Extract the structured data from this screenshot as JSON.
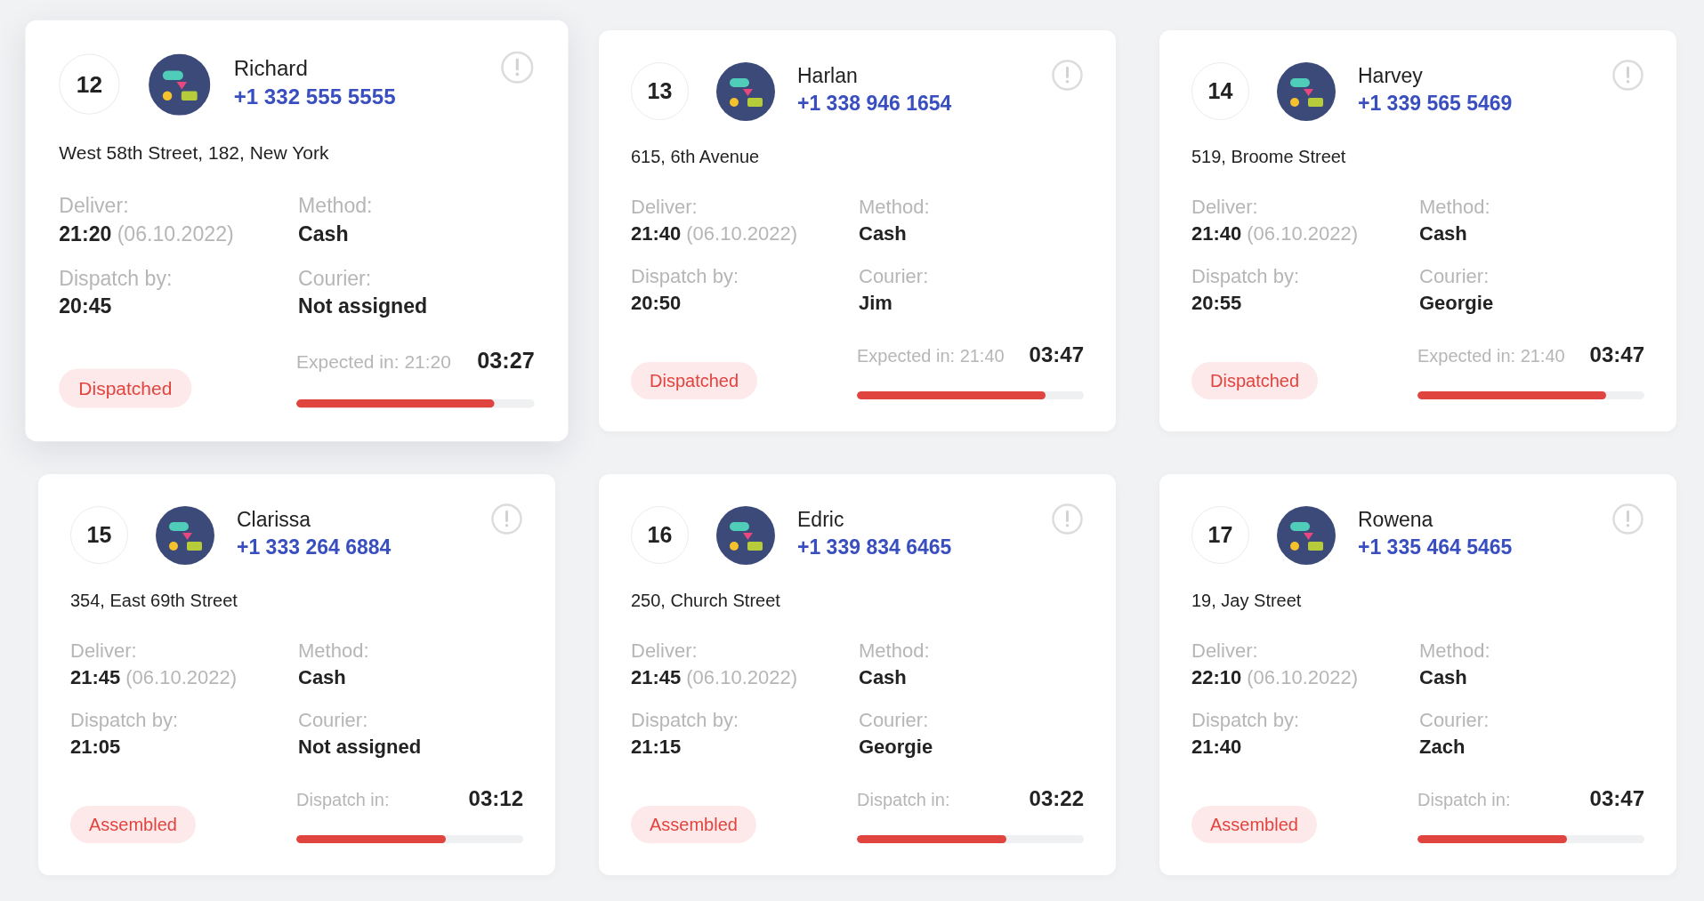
{
  "orders": [
    {
      "number": "12",
      "hovered": true,
      "name": "Richard",
      "phone": "+1 332 555 5555",
      "address": "West 58th Street, 182, New York",
      "fields": [
        {
          "label": "Deliver:",
          "value": "21:20",
          "note": "(06.10.2022)"
        },
        {
          "label": "Method:",
          "value": "Cash"
        },
        {
          "label": "Dispatch by:",
          "value": "20:45"
        },
        {
          "label": "Courier:",
          "value": "Not assigned"
        }
      ],
      "status": "Dispatched",
      "timer": {
        "label": "Expected in: 21:20",
        "value": "03:27",
        "level": 0.83
      }
    },
    {
      "number": "13",
      "hovered": false,
      "name": "Harlan",
      "phone": "+1 338 946 1654",
      "address": "615, 6th Avenue",
      "fields": [
        {
          "label": "Deliver:",
          "value": "21:40",
          "note": "(06.10.2022)"
        },
        {
          "label": "Method:",
          "value": "Cash"
        },
        {
          "label": "Dispatch by:",
          "value": "20:50"
        },
        {
          "label": "Courier:",
          "value": "Jim"
        }
      ],
      "status": "Dispatched",
      "timer": {
        "label": "Expected in: 21:40",
        "value": "03:47",
        "level": 0.83
      }
    },
    {
      "number": "14",
      "hovered": false,
      "name": "Harvey",
      "phone": "+1 339 565 5469",
      "address": "519, Broome Street",
      "fields": [
        {
          "label": "Deliver:",
          "value": "21:40",
          "note": "(06.10.2022)"
        },
        {
          "label": "Method:",
          "value": "Cash"
        },
        {
          "label": "Dispatch by:",
          "value": "20:55"
        },
        {
          "label": "Courier:",
          "value": "Georgie"
        }
      ],
      "status": "Dispatched",
      "timer": {
        "label": "Expected in: 21:40",
        "value": "03:47",
        "level": 0.83
      }
    },
    {
      "number": "15",
      "hovered": false,
      "name": "Clarissa",
      "phone": "+1 333 264 6884",
      "address": "354, East 69th Street",
      "fields": [
        {
          "label": "Deliver:",
          "value": "21:45",
          "note": "(06.10.2022)"
        },
        {
          "label": "Method:",
          "value": "Cash"
        },
        {
          "label": "Dispatch by:",
          "value": "21:05"
        },
        {
          "label": "Courier:",
          "value": "Not assigned"
        }
      ],
      "status": "Assembled",
      "timer": {
        "label": "Dispatch in:",
        "value": "03:12",
        "level": 0.66
      }
    },
    {
      "number": "16",
      "hovered": false,
      "name": "Edric",
      "phone": "+1 339 834 6465",
      "address": "250, Church Street",
      "fields": [
        {
          "label": "Deliver:",
          "value": "21:45",
          "note": "(06.10.2022)"
        },
        {
          "label": "Method:",
          "value": "Cash"
        },
        {
          "label": "Dispatch by:",
          "value": "21:15"
        },
        {
          "label": "Courier:",
          "value": "Georgie"
        }
      ],
      "status": "Assembled",
      "timer": {
        "label": "Dispatch in:",
        "value": "03:22",
        "level": 0.66
      }
    },
    {
      "number": "17",
      "hovered": false,
      "name": "Rowena",
      "phone": "+1 335 464 5465",
      "address": "19, Jay Street",
      "fields": [
        {
          "label": "Deliver:",
          "value": "22:10",
          "note": "(06.10.2022)"
        },
        {
          "label": "Method:",
          "value": "Cash"
        },
        {
          "label": "Dispatch by:",
          "value": "21:40"
        },
        {
          "label": "Courier:",
          "value": "Zach"
        }
      ],
      "status": "Assembled",
      "timer": {
        "label": "Dispatch in:",
        "value": "03:47",
        "level": 0.66
      }
    }
  ]
}
